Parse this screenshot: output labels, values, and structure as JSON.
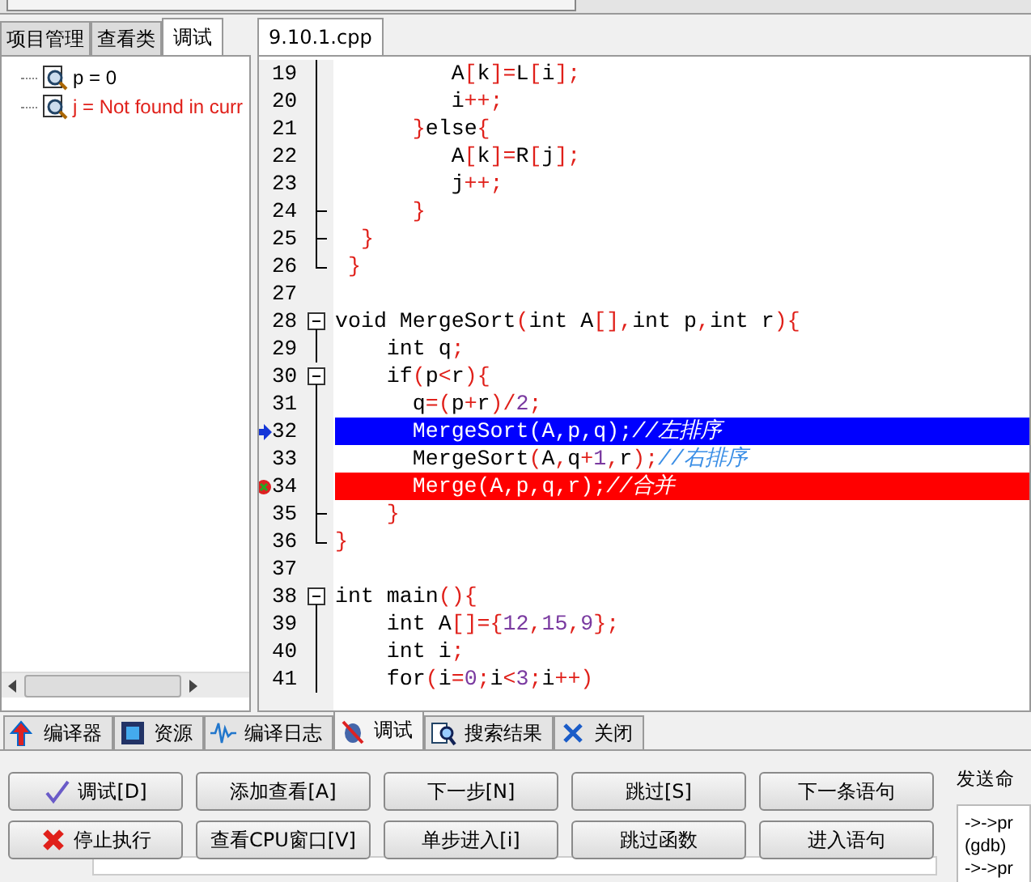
{
  "left_panel": {
    "tabs": [
      {
        "label": "项目管理",
        "selected": false
      },
      {
        "label": "查看类",
        "selected": false
      },
      {
        "label": "调试",
        "selected": true
      }
    ],
    "watches": [
      {
        "text": "p = 0",
        "error": false
      },
      {
        "text": "j = Not found in curr",
        "error": true
      }
    ]
  },
  "editor": {
    "tabs": [
      {
        "label": "9.10.1.cpp",
        "selected": true
      }
    ],
    "lines": [
      {
        "number": "19",
        "code": "         A[k]=L[i];",
        "kind": "body",
        "current": false,
        "breakpoint": false
      },
      {
        "number": "20",
        "code": "         i++;",
        "kind": "body",
        "current": false,
        "breakpoint": false
      },
      {
        "number": "21",
        "code": "      }else{",
        "kind": "body",
        "current": false,
        "breakpoint": false
      },
      {
        "number": "22",
        "code": "         A[k]=R[j];",
        "kind": "body",
        "current": false,
        "breakpoint": false
      },
      {
        "number": "23",
        "code": "         j++;",
        "kind": "body",
        "current": false,
        "breakpoint": false
      },
      {
        "number": "24",
        "code": "      }",
        "kind": "branch",
        "current": false,
        "breakpoint": false
      },
      {
        "number": "25",
        "code": "  }",
        "kind": "branch",
        "current": false,
        "breakpoint": false
      },
      {
        "number": "26",
        "code": " }",
        "kind": "end",
        "current": false,
        "breakpoint": false
      },
      {
        "number": "27",
        "kind": "blank",
        "current": false,
        "breakpoint": false
      },
      {
        "number": "28",
        "code": "void MergeSort(int A[],int p,int r){",
        "kind": "toggle",
        "current": false,
        "breakpoint": false
      },
      {
        "number": "29",
        "code": "    int q;",
        "kind": "body",
        "current": false,
        "breakpoint": false
      },
      {
        "number": "30",
        "code": "    if(p<r){",
        "kind": "toggle",
        "current": false,
        "breakpoint": false
      },
      {
        "number": "31",
        "code": "      q=(p+r)/2;",
        "kind": "body",
        "current": false,
        "breakpoint": false
      },
      {
        "number": "32",
        "code": "      MergeSort(A,p,q);//左排序",
        "kind": "body",
        "current": true,
        "breakpoint": false
      },
      {
        "number": "33",
        "code": "      MergeSort(A,q+1,r);//右排序",
        "kind": "body",
        "current": false,
        "breakpoint": false
      },
      {
        "number": "34",
        "code": "      Merge(A,p,q,r);//合并",
        "kind": "body",
        "current": false,
        "breakpoint": true
      },
      {
        "number": "35",
        "code": "    }",
        "kind": "branch",
        "current": false,
        "breakpoint": false
      },
      {
        "number": "36",
        "code": "}",
        "kind": "end",
        "current": false,
        "breakpoint": false
      },
      {
        "number": "37",
        "kind": "blank",
        "current": false,
        "breakpoint": false
      },
      {
        "number": "38",
        "code": "int main(){",
        "kind": "toggle",
        "current": false,
        "breakpoint": false
      },
      {
        "number": "39",
        "code": "    int A[]={12,15,9};",
        "kind": "body",
        "current": false,
        "breakpoint": false
      },
      {
        "number": "40",
        "code": "    int i;",
        "kind": "body",
        "current": false,
        "breakpoint": false
      },
      {
        "number": "41",
        "code": "    for(i=0;i<3;i++)",
        "kind": "body",
        "current": false,
        "breakpoint": false
      }
    ]
  },
  "bottom_tabs": [
    {
      "label": "编译器",
      "selected": false
    },
    {
      "label": "资源",
      "selected": false
    },
    {
      "label": "编译日志",
      "selected": false
    },
    {
      "label": "调试",
      "selected": true
    },
    {
      "label": "搜索结果",
      "selected": false
    },
    {
      "label": "关闭",
      "selected": false
    }
  ],
  "debug_buttons": [
    "调试[D]",
    "添加查看[A]",
    "下一步[N]",
    "跳过[S]",
    "下一条语句",
    "停止执行",
    "查看CPU窗口[V]",
    "单步进入[i]",
    "跳过函数",
    "进入语句"
  ],
  "command_panel": {
    "label": "发送命",
    "output": [
      "->->pr",
      "(gdb)",
      "->->pr"
    ]
  }
}
